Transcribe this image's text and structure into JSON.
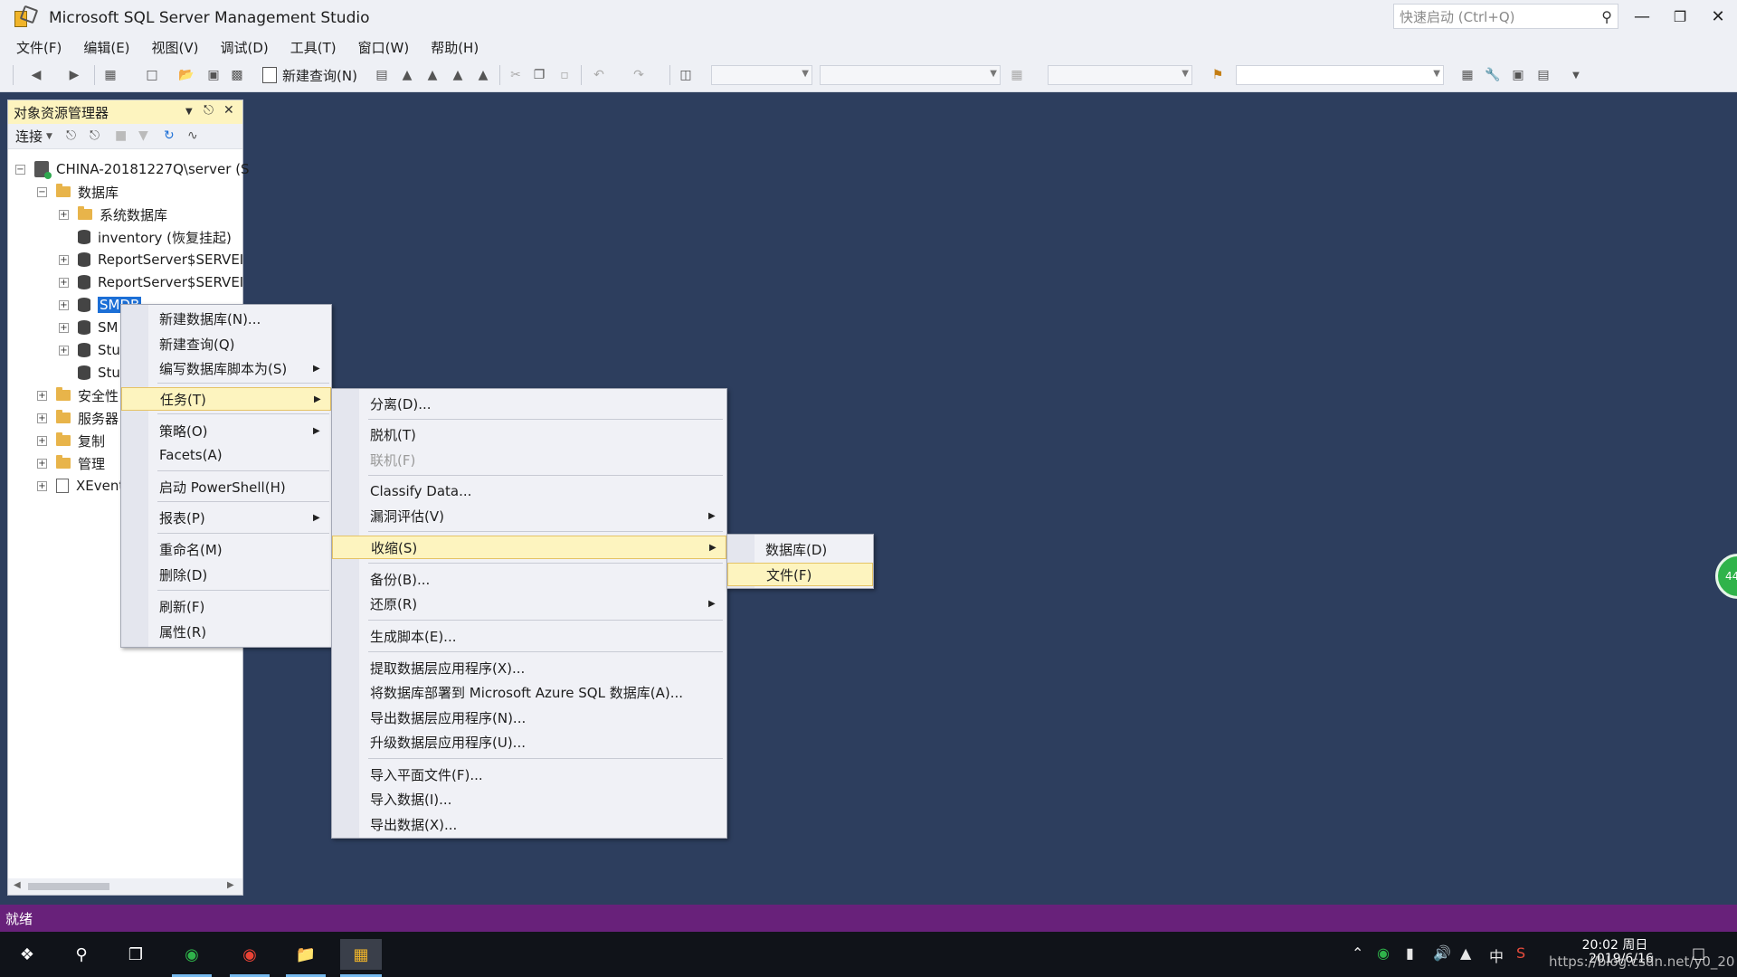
{
  "window": {
    "title": "Microsoft SQL Server Management Studio",
    "quick_launch_placeholder": "快速启动 (Ctrl+Q)",
    "minimize": "—",
    "restore": "❐",
    "close": "✕"
  },
  "menubar": [
    "文件(F)",
    "编辑(E)",
    "视图(V)",
    "调试(D)",
    "工具(T)",
    "窗口(W)",
    "帮助(H)"
  ],
  "toolbar": {
    "new_query_label": "新建查询(N)"
  },
  "object_explorer": {
    "title": "对象资源管理器",
    "connect_label": "连接",
    "tree": [
      {
        "label": "CHINA-20181227Q\\server (S",
        "icon": "server-icon",
        "expander": "−"
      },
      {
        "label": "数据库",
        "icon": "folder-icon",
        "expander": "−"
      },
      {
        "label": "系统数据库",
        "icon": "folder-icon",
        "expander": "+"
      },
      {
        "label": "inventory (恢复挂起)",
        "icon": "database-icon",
        "expander": ""
      },
      {
        "label": "ReportServer$SERVEI",
        "icon": "database-icon",
        "expander": "+"
      },
      {
        "label": "ReportServer$SERVEI",
        "icon": "database-icon",
        "expander": "+"
      },
      {
        "label": "SMDB",
        "icon": "database-icon",
        "expander": "+",
        "selected": true
      },
      {
        "label": "SM",
        "icon": "database-icon",
        "expander": "+"
      },
      {
        "label": "Stu",
        "icon": "database-icon",
        "expander": "+"
      },
      {
        "label": "Stu",
        "icon": "database-icon",
        "expander": ""
      },
      {
        "label": "安全性",
        "icon": "folder-icon",
        "expander": "+"
      },
      {
        "label": "服务器",
        "icon": "folder-icon",
        "expander": "+"
      },
      {
        "label": "复制",
        "icon": "folder-icon",
        "expander": "+"
      },
      {
        "label": "管理",
        "icon": "folder-icon",
        "expander": "+"
      },
      {
        "label": "XEvent",
        "icon": "xevent-icon",
        "expander": "+"
      }
    ]
  },
  "context_menu": {
    "items": [
      "新建数据库(N)...",
      "新建查询(Q)",
      "编写数据库脚本为(S)",
      "任务(T)",
      "策略(O)",
      "Facets(A)",
      "启动 PowerShell(H)",
      "报表(P)",
      "重命名(M)",
      "删除(D)",
      "刷新(F)",
      "属性(R)"
    ]
  },
  "tasks_menu": {
    "items": [
      "分离(D)...",
      "脱机(T)",
      "联机(F)",
      "Classify Data...",
      "漏洞评估(V)",
      "收缩(S)",
      "备份(B)...",
      "还原(R)",
      "生成脚本(E)...",
      "提取数据层应用程序(X)...",
      "将数据库部署到 Microsoft Azure SQL 数据库(A)...",
      "导出数据层应用程序(N)...",
      "升级数据层应用程序(U)...",
      "导入平面文件(F)...",
      "导入数据(I)...",
      "导出数据(X)..."
    ]
  },
  "shrink_menu": {
    "items": [
      "数据库(D)",
      "文件(F)"
    ]
  },
  "status": {
    "text": "就绪"
  },
  "taskbar": {
    "time": "20:02 周日",
    "date": "2019/6/16",
    "ime": "中",
    "watermark": "https://blog.csdn.net/y0_20"
  },
  "side_badge": "44"
}
